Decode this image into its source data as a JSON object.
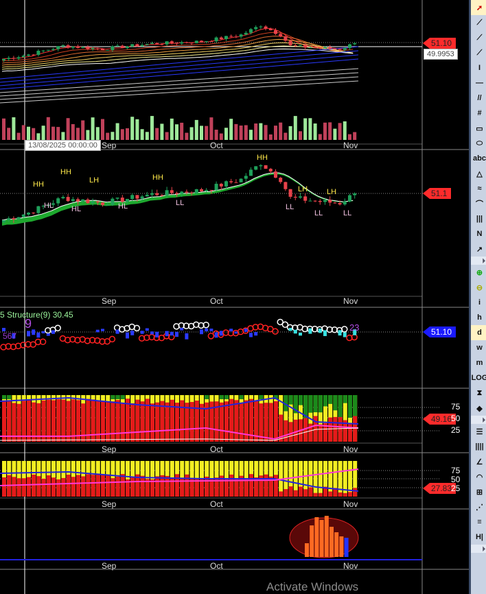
{
  "crosshair_date": "13/08/2025 00:00:00",
  "months": [
    "Sep",
    "Oct",
    "Nov"
  ],
  "panel1": {
    "last_price": "51.10",
    "crosshair_price": "49.9953"
  },
  "panel2": {
    "last_price": "51.1",
    "swing_labels": [
      "HH",
      "HH",
      "LH",
      "HH",
      "HH",
      "LH",
      "LH",
      "HL",
      "HL",
      "HL",
      "LL",
      "LL",
      "LL",
      "LL"
    ]
  },
  "panel3": {
    "title": "5 Structure(9) 30.45",
    "last_price": "51.10",
    "count_left": "567",
    "count_big": "9",
    "count_right": "23"
  },
  "panel4": {
    "value": "49.16",
    "levels": [
      "75",
      "50",
      "25"
    ]
  },
  "panel5": {
    "value": "27.83",
    "levels": [
      "75",
      "50",
      "25"
    ]
  },
  "watermark": "Activate Windows",
  "toolbar": [
    "pointer",
    "line",
    "ray",
    "extended-line",
    "vertical-line",
    "horizontal-line",
    "parallel-channel",
    "pitchfork",
    "rectangle",
    "ellipse",
    "text",
    "triangle",
    "fib-arcs",
    "arc",
    "cycle-lines",
    "zigzag",
    "arrow",
    "more",
    "zoom-in",
    "zoom-out",
    "info",
    "hand",
    "daily",
    "weekly",
    "monthly",
    "LOG",
    "fit-vertical",
    "fit",
    "more",
    "gann-lines",
    "vertical-lines",
    "fan",
    "arcs",
    "grid",
    "fib-fan",
    "speed-lines",
    "time-zones",
    "more"
  ],
  "colors": {
    "up": "#1fa05a",
    "down": "#e8424a",
    "tag": "#ff2b2b",
    "blue": "#1a1aff"
  },
  "chart_data": {
    "type": "candlestick",
    "x_labels": [
      "Sep",
      "Oct",
      "Nov"
    ],
    "close_keypoints": [
      [
        0,
        47.5
      ],
      [
        5,
        48.5
      ],
      [
        12,
        50.5
      ],
      [
        20,
        49.8
      ],
      [
        30,
        51
      ],
      [
        40,
        51.5
      ],
      [
        48,
        53
      ],
      [
        52,
        55.2
      ],
      [
        56,
        53
      ],
      [
        58,
        50.5
      ],
      [
        64,
        50
      ],
      [
        68,
        49.8
      ],
      [
        71,
        51.1
      ]
    ],
    "last": 51.1
  }
}
